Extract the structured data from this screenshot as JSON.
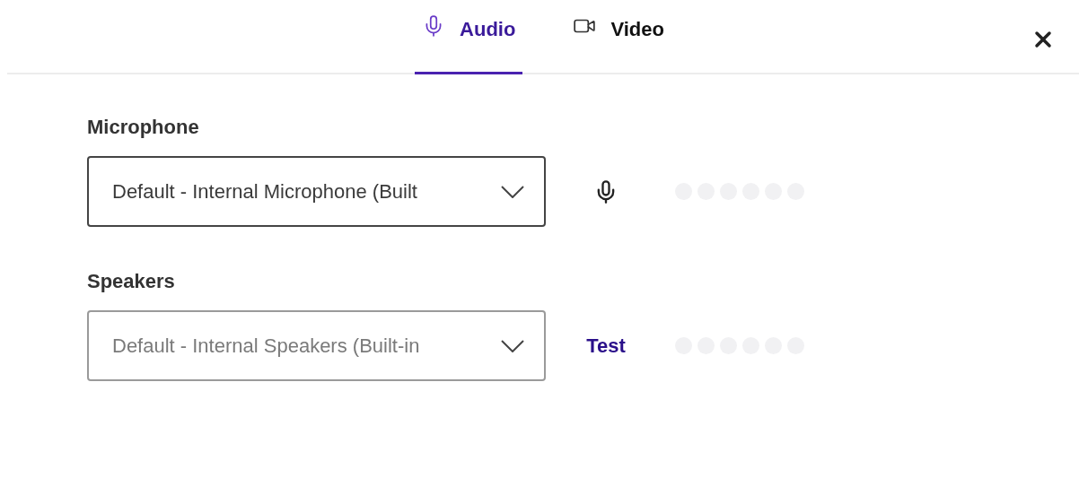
{
  "tabs": [
    {
      "label": "Audio",
      "kind": "audio",
      "selected": true
    },
    {
      "label": "Video",
      "kind": "video",
      "selected": false
    }
  ],
  "devices": [
    {
      "label": "Microphone",
      "value": "Default - Internal Microphone (Built",
      "disabled": false,
      "kind": "mic",
      "meter": {
        "level": 0
      }
    },
    {
      "label": "Speakers",
      "value": "Default - Internal Speakers (Built-in",
      "disabled": true,
      "kind": "test",
      "action": "Test",
      "meter": {
        "level": 0
      }
    }
  ]
}
